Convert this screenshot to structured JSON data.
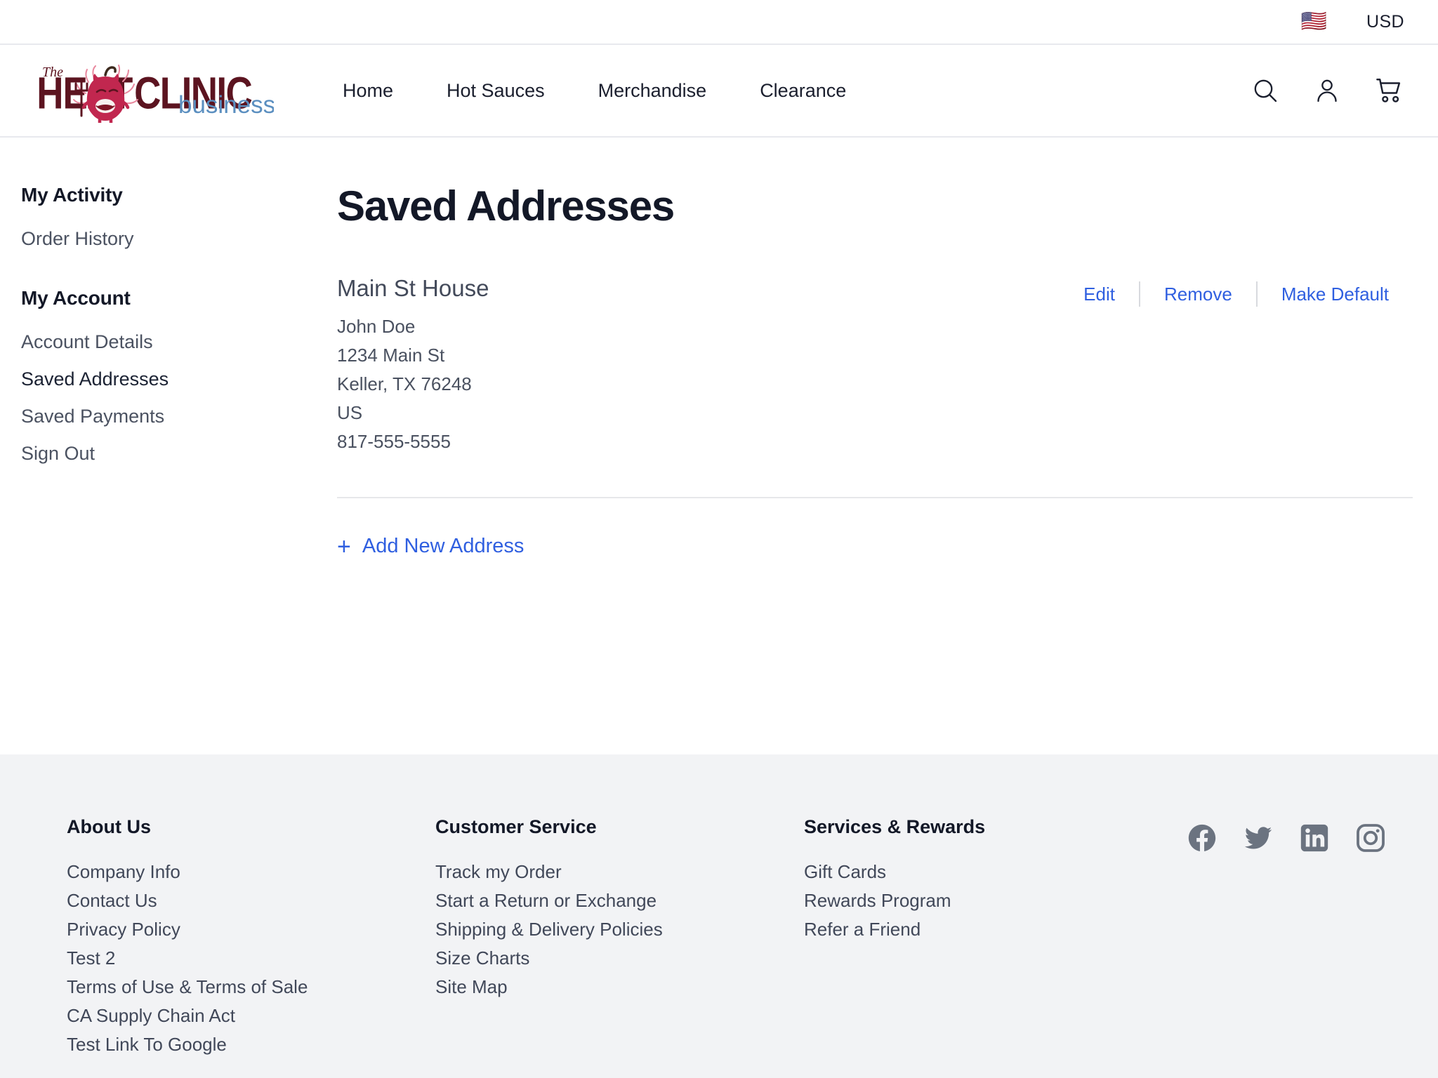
{
  "topbar": {
    "flag_icon": "us-flag-icon",
    "flag_glyph": "🇺🇸",
    "currency": "USD"
  },
  "header": {
    "logo": {
      "the": "The",
      "heat": "HEAT",
      "clinic": "CLINIC",
      "business": "business",
      "mascot_icon": "chili-pepper-devil-icon",
      "color_dark": "#5c1420",
      "color_pepper": "#c1274f",
      "color_business": "#5b8fc0"
    },
    "nav": [
      {
        "label": "Home",
        "name": "nav-item-home"
      },
      {
        "label": "Hot Sauces",
        "name": "nav-item-hot-sauces"
      },
      {
        "label": "Merchandise",
        "name": "nav-item-merchandise"
      },
      {
        "label": "Clearance",
        "name": "nav-item-clearance"
      }
    ],
    "actions": [
      {
        "icon": "search-icon"
      },
      {
        "icon": "user-account-icon"
      },
      {
        "icon": "shopping-cart-icon"
      }
    ]
  },
  "sidebar": {
    "groups": [
      {
        "heading": "My Activity",
        "items": [
          {
            "label": "Order History",
            "active": false
          }
        ]
      },
      {
        "heading": "My Account",
        "items": [
          {
            "label": "Account Details",
            "active": false
          },
          {
            "label": "Saved Addresses",
            "active": true
          },
          {
            "label": "Saved Payments",
            "active": false
          },
          {
            "label": "Sign Out",
            "active": false
          }
        ]
      }
    ]
  },
  "main": {
    "page_title": "Saved Addresses",
    "address": {
      "nickname": "Main St House",
      "recipient": "John Doe",
      "street": "1234 Main St",
      "city_state_zip": "Keller, TX 76248",
      "country": "US",
      "phone": "817-555-5555",
      "actions": {
        "edit": "Edit",
        "remove": "Remove",
        "make_default": "Make Default"
      }
    },
    "add_new_label": "Add New Address",
    "add_new_icon": "plus-icon",
    "link_color": "#2f5fe0"
  },
  "footer": {
    "columns": [
      {
        "heading": "About Us",
        "links": [
          "Company Info",
          "Contact Us",
          "Privacy Policy",
          "Test 2",
          "Terms of Use & Terms of Sale",
          "CA Supply Chain Act",
          "Test Link To Google"
        ]
      },
      {
        "heading": "Customer Service",
        "links": [
          "Track my Order",
          "Start a Return or Exchange",
          "Shipping & Delivery Policies",
          "Size Charts",
          "Site Map"
        ]
      },
      {
        "heading": "Services & Rewards",
        "links": [
          "Gift Cards",
          "Rewards Program",
          "Refer a Friend"
        ]
      }
    ],
    "socials": [
      {
        "icon": "facebook-icon"
      },
      {
        "icon": "twitter-icon"
      },
      {
        "icon": "linkedin-icon"
      },
      {
        "icon": "instagram-icon"
      }
    ],
    "background": "#f2f3f5",
    "icon_color": "#6b7380"
  }
}
